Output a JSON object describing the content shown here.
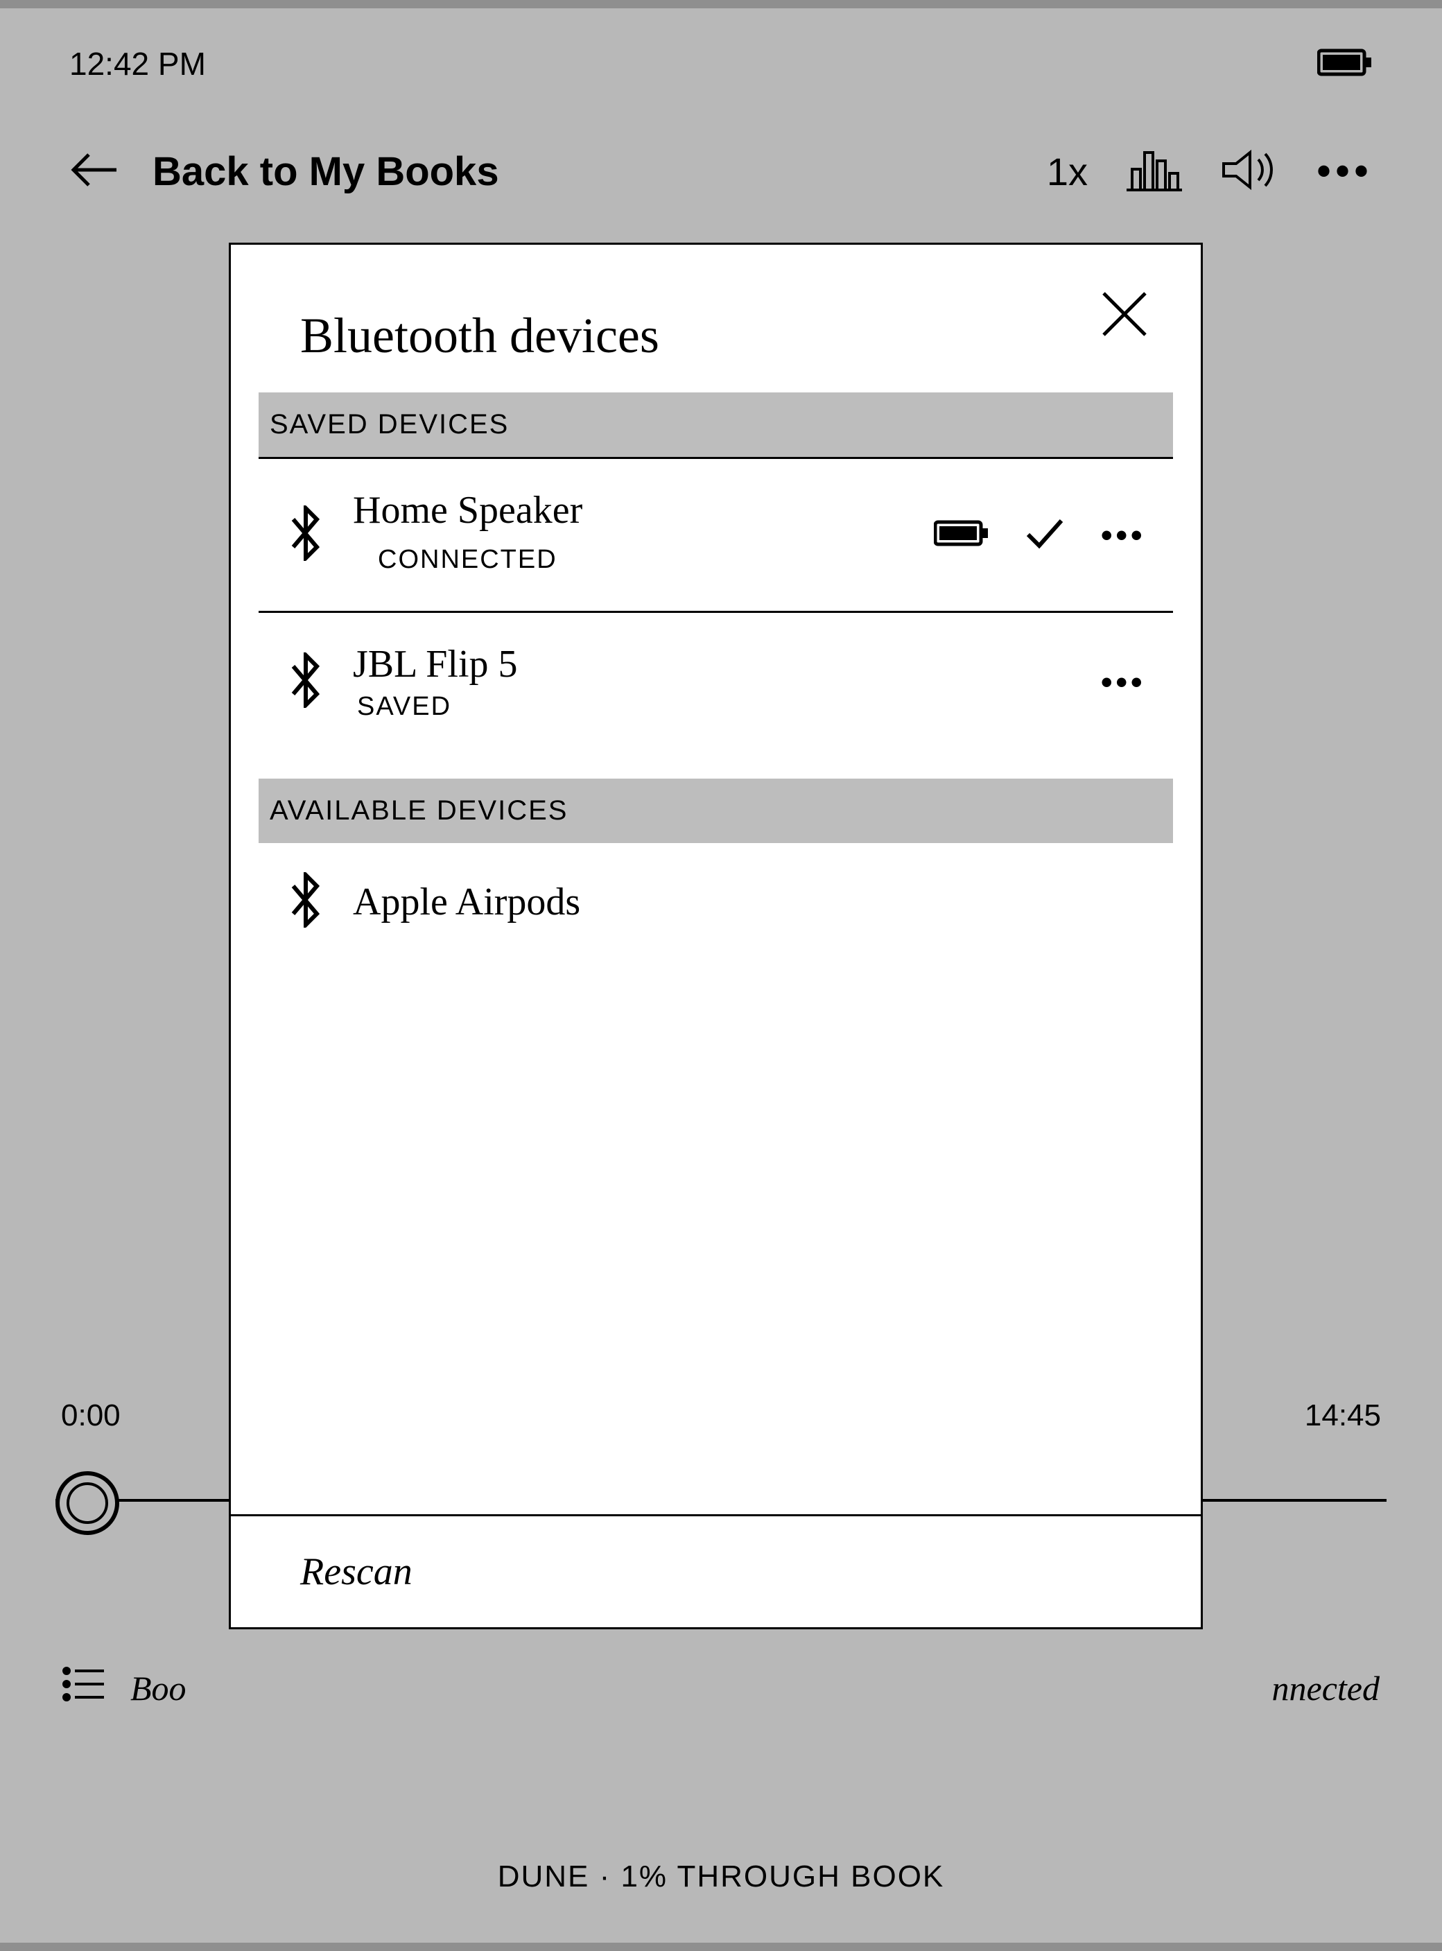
{
  "status": {
    "time": "12:42 PM"
  },
  "nav": {
    "back_label": "Back to My Books",
    "speed": "1x"
  },
  "player": {
    "elapsed": "0:00",
    "remaining": "14:45"
  },
  "bottom": {
    "left_partial": "Boo",
    "right_partial": "nnected"
  },
  "footer": {
    "text": "DUNE · 1% THROUGH BOOK"
  },
  "modal": {
    "title": "Bluetooth devices",
    "section_saved": "SAVED DEVICES",
    "section_available": "AVAILABLE DEVICES",
    "saved_devices": [
      {
        "name": "Home Speaker",
        "status": "CONNECTED",
        "connected": true
      },
      {
        "name": "JBL Flip 5",
        "status": "SAVED",
        "connected": false
      }
    ],
    "available_devices": [
      {
        "name": "Apple Airpods"
      }
    ],
    "rescan_label": "Rescan"
  }
}
